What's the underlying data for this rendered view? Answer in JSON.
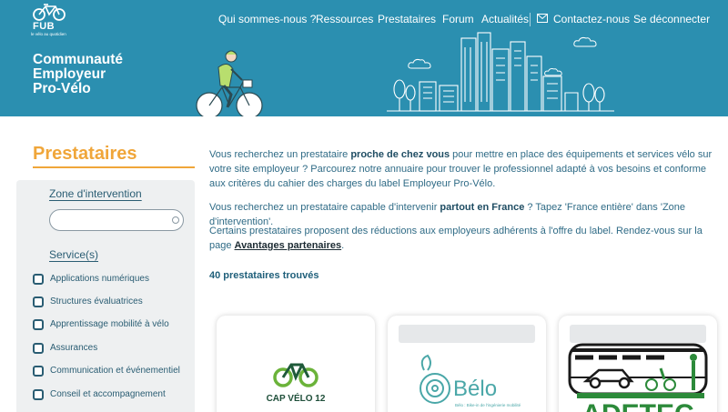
{
  "header": {
    "logo_text": "FUB",
    "logo_tagline": "le vélo au quotidien",
    "site_title_lines": [
      "Communauté",
      "Employeur",
      "Pro-Vélo"
    ],
    "bg_color": "#2b8fb0"
  },
  "nav": {
    "items": [
      {
        "label": "Qui sommes-nous ?"
      },
      {
        "label": "Ressources"
      },
      {
        "label": "Prestataires"
      },
      {
        "label": "Forum"
      },
      {
        "label": "Actualités"
      },
      {
        "label": "Contactez-nous",
        "icon": "mail-icon"
      },
      {
        "label": "Se déconnecter"
      }
    ]
  },
  "page": {
    "heading": "Prestataires",
    "accent_color": "#f0a63a"
  },
  "filters": {
    "zone_label": "Zone d'intervention",
    "zone_value": "",
    "services_label": "Service(s)",
    "services": [
      "Applications numériques",
      "Structures évaluatrices",
      "Apprentissage mobilité à vélo",
      "Assurances",
      "Communication et événementiel",
      "Conseil et accompagnement"
    ]
  },
  "intro": {
    "p1_a": "Vous recherchez un prestataire ",
    "p1_b": "proche de chez vous",
    "p1_c": " pour mettre en place des équipements et services vélo sur votre site employeur ? Parcourez notre annuaire pour trouver le professionnel adapté à vos besoins et conforme aux critères du cahier des charges du label Employeur Pro-Vélo.",
    "p2_a": "Vous recherchez un prestataire capable d'intervenir ",
    "p2_b": "partout en France",
    "p2_c": " ? Tapez 'France entière' dans 'Zone d'intervention'.",
    "p3_a": "Certains prestataires proposent des réductions aux employeurs adhérents à l'offre du label. Rendez-vous sur la page ",
    "p3_link": "Avantages partenaires",
    "p3_c": "."
  },
  "results": {
    "count_text": "40 prestataires trouvés"
  },
  "cards": [
    {
      "name": "CAP VÉLO 12"
    },
    {
      "name": "Bélo",
      "tagline": "Bélo : Bike-in de l'ingénierie mobilité"
    },
    {
      "name": "ADETEC"
    }
  ]
}
